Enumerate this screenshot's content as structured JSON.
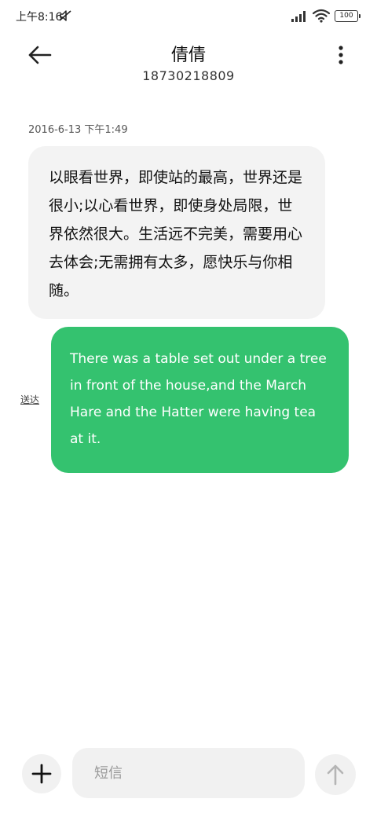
{
  "status_bar": {
    "time": "上午8:16",
    "battery": "100",
    "icons": [
      "mute-icon",
      "signal-icon",
      "wifi-icon",
      "battery-icon"
    ]
  },
  "header": {
    "contact_name": "倩倩",
    "contact_number": "18730218809",
    "icons": [
      "back-arrow-icon",
      "more-vertical-icon"
    ]
  },
  "conversation": {
    "timestamp": "2016-6-13 下午1:49",
    "messages": [
      {
        "direction": "incoming",
        "text": "以眼看世界，即使站的最高，世界还是很小;以心看世界，即使身处局限，世界依然很大。生活远不完美，需要用心去体会;无需拥有太多，愿快乐与你相随。"
      },
      {
        "direction": "outgoing",
        "text": "There was a table set out under a tree in front of the house,and the March Hare and the Hatter were having tea at it.",
        "status": "送达"
      }
    ]
  },
  "composer": {
    "placeholder": "短信",
    "value": "",
    "icons": [
      "plus-icon",
      "send-arrow-icon"
    ]
  },
  "colors": {
    "outgoing_bubble": "#34c26f",
    "incoming_bubble": "#f3f3f3",
    "background": "#ffffff"
  }
}
